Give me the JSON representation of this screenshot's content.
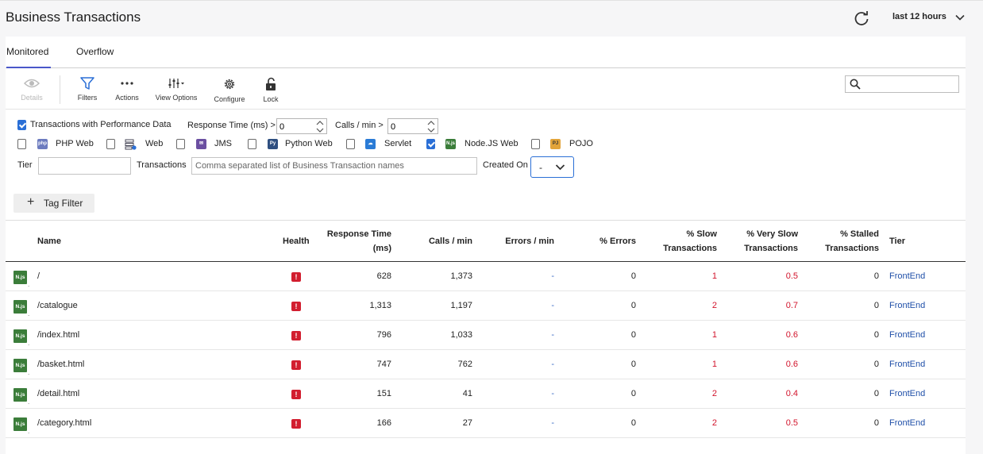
{
  "header": {
    "title": "Business Transactions",
    "time_range": "last 12 hours"
  },
  "tabs": [
    {
      "label": "Monitored"
    },
    {
      "label": "Overflow"
    }
  ],
  "toolbar": {
    "details": "Details",
    "filters": "Filters",
    "actions": "Actions",
    "view_options": "View Options",
    "configure": "Configure",
    "lock": "Lock",
    "search_value": ""
  },
  "filters": {
    "perf_data_label": "Transactions with Performance Data",
    "perf_data_checked": true,
    "response_time_label": "Response Time (ms) >",
    "response_time_value": "0",
    "calls_label": "Calls / min >",
    "calls_value": "0",
    "types": [
      {
        "label": "PHP Web",
        "icon": "php-icon",
        "checked": false
      },
      {
        "label": "Web",
        "icon": "web-server-icon",
        "checked": false
      },
      {
        "label": "JMS",
        "icon": "jms-icon",
        "checked": false
      },
      {
        "label": "Python Web",
        "icon": "python-icon",
        "checked": false
      },
      {
        "label": "Servlet",
        "icon": "servlet-cloud-icon",
        "checked": false
      },
      {
        "label": "Node.JS Web",
        "icon": "nodejs-icon",
        "checked": true
      },
      {
        "label": "POJO",
        "icon": "pojo-icon",
        "checked": false
      }
    ],
    "tier_label": "Tier",
    "tier_value": "",
    "transactions_label": "Transactions",
    "transactions_placeholder": "Comma separated list of Business Transaction names",
    "created_on_label": "Created On",
    "created_on_value": "-",
    "tag_filter": "Tag Filter"
  },
  "table": {
    "headers": {
      "name": "Name",
      "health": "Health",
      "response_time_1": "Response Time",
      "response_time_2": "(ms)",
      "calls": "Calls / min",
      "errors": "Errors / min",
      "pct_errors": "% Errors",
      "slow_1": "% Slow",
      "slow_2": "Transactions",
      "very_slow_1": "% Very Slow",
      "very_slow_2": "Transactions",
      "stalled_1": "% Stalled",
      "stalled_2": "Transactions",
      "tier": "Tier"
    },
    "rows": [
      {
        "icon": "N.js",
        "name": "/",
        "health": "!",
        "response_time": "628",
        "calls": "1,373",
        "errors": "-",
        "pct_errors": "0",
        "slow": "1",
        "very_slow": "0.5",
        "stalled": "0",
        "tier": "FrontEnd"
      },
      {
        "icon": "N.js",
        "name": "/catalogue",
        "health": "!",
        "response_time": "1,313",
        "calls": "1,197",
        "errors": "-",
        "pct_errors": "0",
        "slow": "2",
        "very_slow": "0.7",
        "stalled": "0",
        "tier": "FrontEnd"
      },
      {
        "icon": "N.js",
        "name": "/index.html",
        "health": "!",
        "response_time": "796",
        "calls": "1,033",
        "errors": "-",
        "pct_errors": "0",
        "slow": "1",
        "very_slow": "0.6",
        "stalled": "0",
        "tier": "FrontEnd"
      },
      {
        "icon": "N.js",
        "name": "/basket.html",
        "health": "!",
        "response_time": "747",
        "calls": "762",
        "errors": "-",
        "pct_errors": "0",
        "slow": "1",
        "very_slow": "0.6",
        "stalled": "0",
        "tier": "FrontEnd"
      },
      {
        "icon": "N.js",
        "name": "/detail.html",
        "health": "!",
        "response_time": "151",
        "calls": "41",
        "errors": "-",
        "pct_errors": "0",
        "slow": "2",
        "very_slow": "0.4",
        "stalled": "0",
        "tier": "FrontEnd"
      },
      {
        "icon": "N.js",
        "name": "/category.html",
        "health": "!",
        "response_time": "166",
        "calls": "27",
        "errors": "-",
        "pct_errors": "0",
        "slow": "2",
        "very_slow": "0.5",
        "stalled": "0",
        "tier": "FrontEnd"
      }
    ]
  },
  "colors": {
    "accent": "#4a57c9",
    "critical": "#d21e2f",
    "link": "#1f4fa8",
    "nodejs": "#3b7d3a"
  }
}
